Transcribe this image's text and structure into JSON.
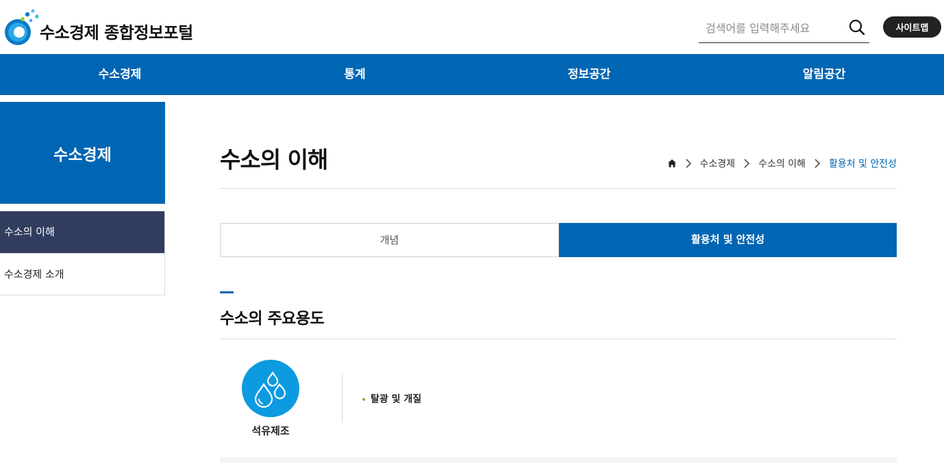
{
  "header": {
    "site_title": "수소경제 종합정보포털",
    "search_placeholder": "검색어를 입력해주세요",
    "sitemap_label": "사이트맵"
  },
  "gnb": {
    "items": [
      {
        "label": "수소경제"
      },
      {
        "label": "통계"
      },
      {
        "label": "정보공간"
      },
      {
        "label": "알림공간"
      }
    ]
  },
  "sidebar": {
    "title": "수소경제",
    "items": [
      {
        "label": "수소의 이해",
        "active": true
      },
      {
        "label": "수소경제 소개",
        "active": false
      }
    ]
  },
  "main": {
    "page_title": "수소의 이해",
    "breadcrumb": [
      "수소경제",
      "수소의 이해",
      "활용처 및 안전성"
    ],
    "tabs": [
      {
        "label": "개념",
        "active": false
      },
      {
        "label": "활용처 및 안전성",
        "active": true
      }
    ],
    "section_title": "수소의 주요용도",
    "uses": [
      {
        "icon": "water-drops-icon",
        "label": "석유제조",
        "items": [
          "탈광 및 개질"
        ]
      }
    ]
  },
  "colors": {
    "primary": "#0066b3",
    "sidebar_active": "#313d5f",
    "icon_circle": "#0c9be0",
    "bullet": "#7cb342"
  }
}
